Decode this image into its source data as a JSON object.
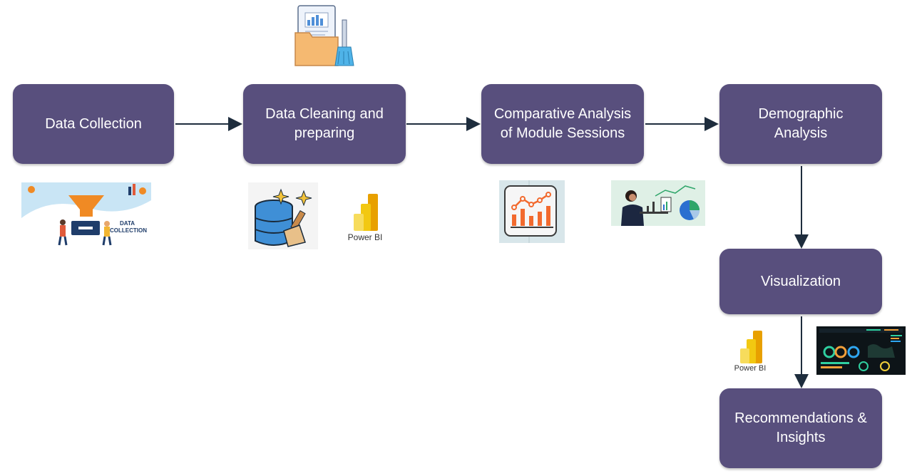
{
  "steps": {
    "data_collection": "Data Collection",
    "cleaning_line1": "Data Cleaning and",
    "cleaning_line2": "preparing",
    "comparative_line1": "Comparative Analysis",
    "comparative_line2": "of Module Sessions",
    "demographic_line1": "Demographic",
    "demographic_line2": "Analysis",
    "visualization": "Visualization",
    "recommendations_line1": "Recommendations &",
    "recommendations_line2": "Insights"
  },
  "images": {
    "data_collection_text_1": "DATA",
    "data_collection_text_2": "COLLECTION",
    "powerbi_label_1": "Power BI",
    "powerbi_label_2": "Power BI"
  },
  "colors": {
    "box_fill": "#584f7d",
    "box_text": "#ffffff",
    "arrow": "#1e2d3d",
    "powerbi_yellow": "#f2c811",
    "powerbi_orange": "#e8a000"
  },
  "icons": [
    "folder-chart-broom-icon",
    "data-collection-illustration",
    "database-cleaning-icon",
    "powerbi-logo",
    "line-chart-icon",
    "analyst-at-desk-illustration",
    "powerbi-logo",
    "dashboard-screenshot"
  ]
}
